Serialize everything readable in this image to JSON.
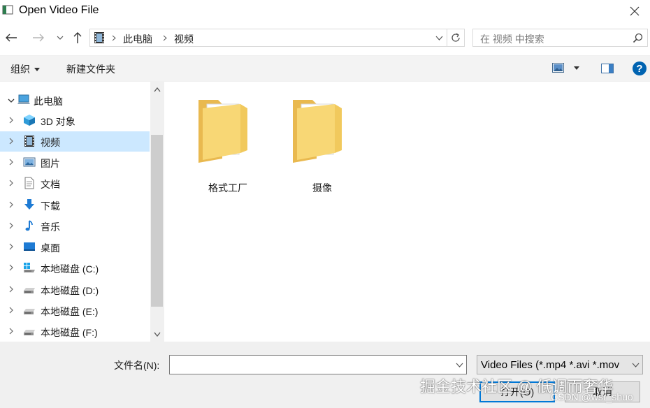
{
  "window": {
    "title": "Open Video File"
  },
  "nav": {
    "breadcrumb": [
      "此电脑",
      "视频"
    ],
    "search_placeholder": "在 视频 中搜索"
  },
  "toolbar": {
    "organize_label": "组织",
    "new_folder_label": "新建文件夹"
  },
  "sidebar": {
    "root": {
      "label": "此电脑",
      "icon": "computer-icon"
    },
    "items": [
      {
        "label": "3D 对象",
        "icon": "cube-3d-icon"
      },
      {
        "label": "视频",
        "icon": "film-icon",
        "selected": true
      },
      {
        "label": "图片",
        "icon": "picture-icon"
      },
      {
        "label": "文档",
        "icon": "document-icon"
      },
      {
        "label": "下载",
        "icon": "download-arrow-icon"
      },
      {
        "label": "音乐",
        "icon": "music-note-icon"
      },
      {
        "label": "桌面",
        "icon": "desktop-icon"
      },
      {
        "label": "本地磁盘 (C:)",
        "icon": "windows-drive-icon"
      },
      {
        "label": "本地磁盘 (D:)",
        "icon": "drive-icon"
      },
      {
        "label": "本地磁盘 (E:)",
        "icon": "drive-icon"
      },
      {
        "label": "本地磁盘 (F:)",
        "icon": "drive-icon"
      }
    ]
  },
  "files": [
    {
      "name": "格式工厂",
      "icon": "folder-icon"
    },
    {
      "name": "摄像",
      "icon": "folder-icon"
    }
  ],
  "footer": {
    "filename_label": "文件名(N):",
    "filename_value": "",
    "filter_value": "Video Files (*.mp4 *.avi *.mov",
    "open_label": "打开(O)",
    "cancel_label": "取消"
  },
  "watermark": {
    "line1": "掘金技术社区 @ 低调而奢华",
    "line2": "CSDN @wsr_shuo"
  },
  "colors": {
    "selection": "#cce8ff",
    "accent": "#0078d7",
    "folder": "#f8d775"
  }
}
